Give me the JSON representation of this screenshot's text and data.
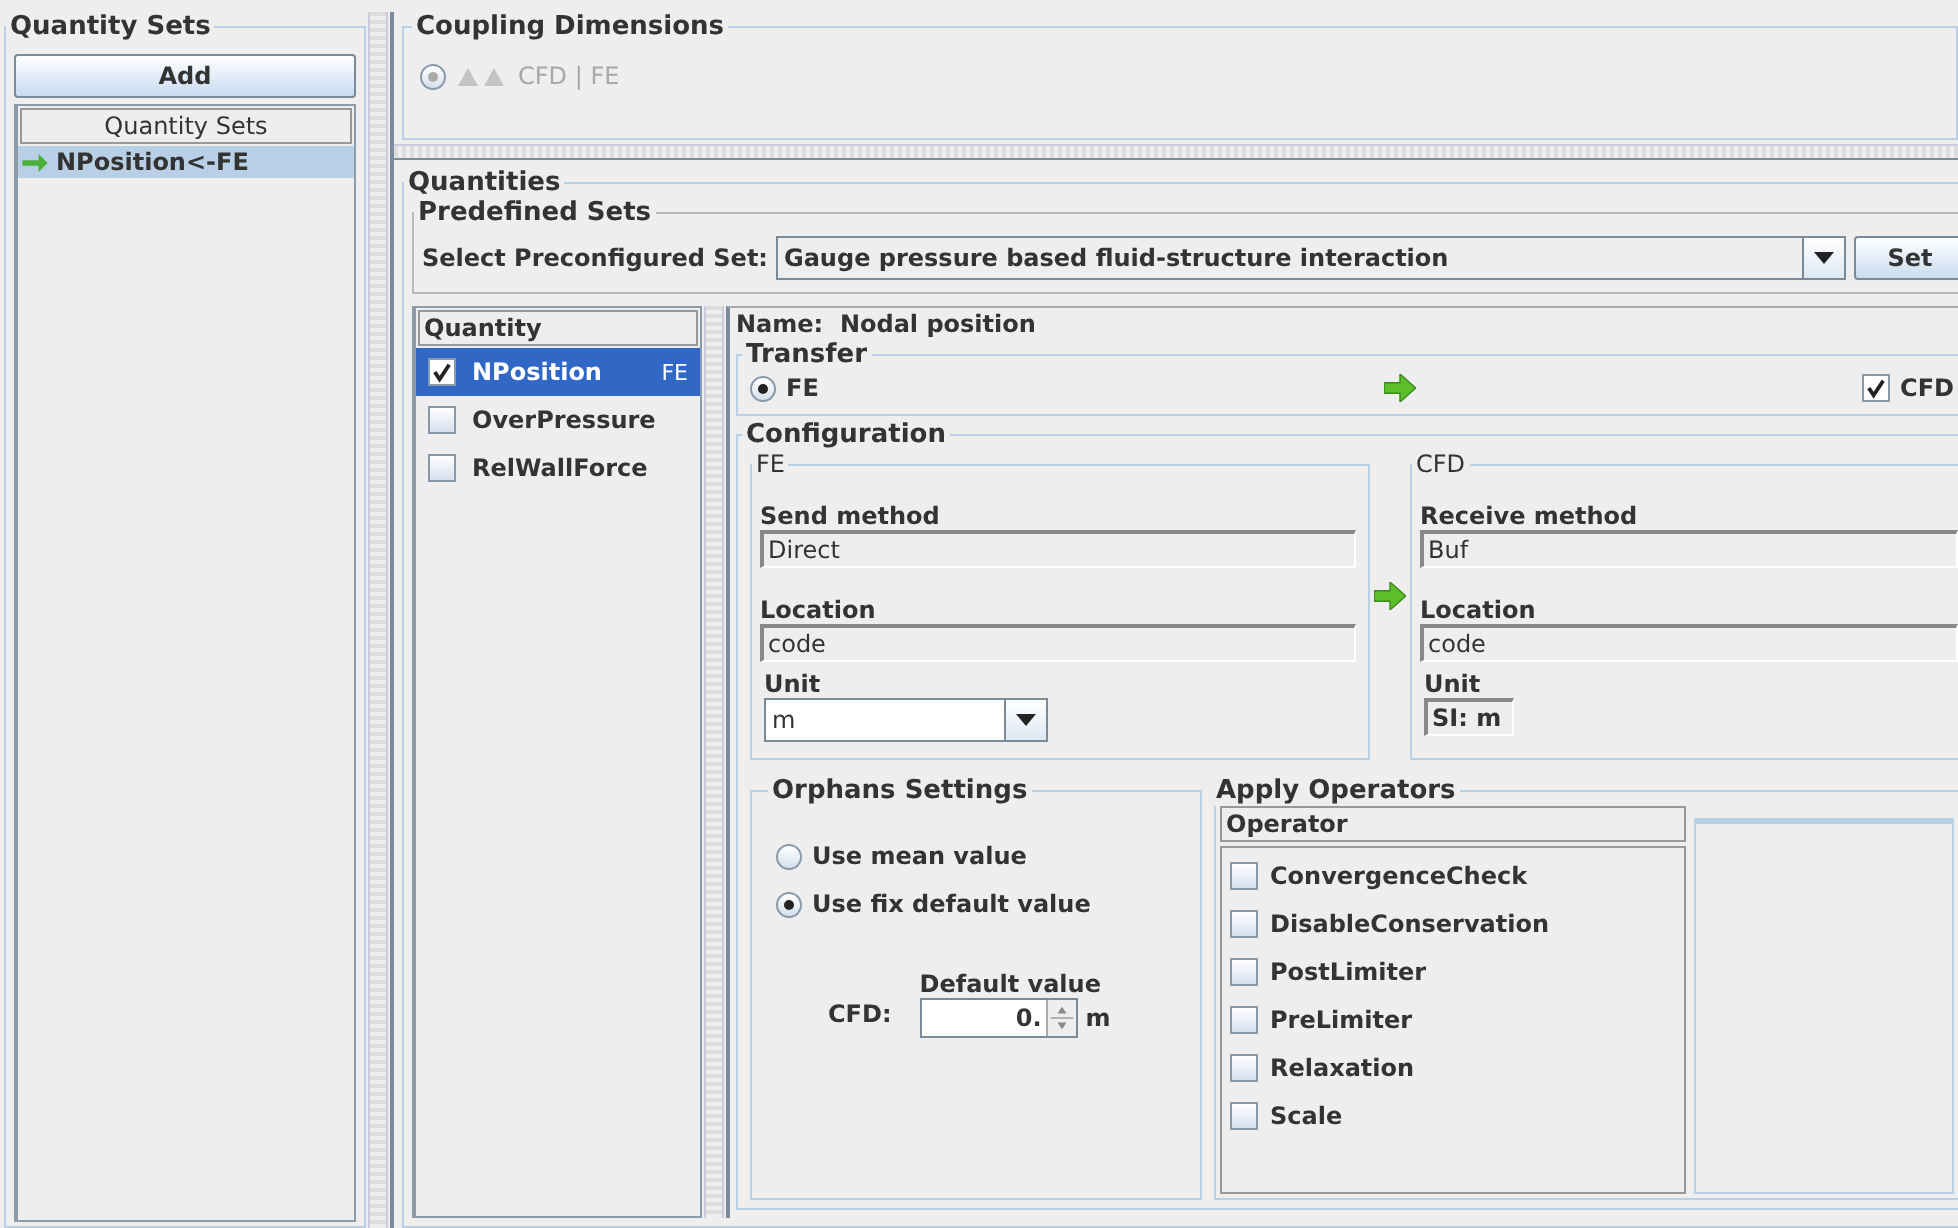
{
  "quantity_sets": {
    "title": "Quantity Sets",
    "add_button": "Add",
    "list_header": "Quantity Sets",
    "items": [
      {
        "label": "NPosition<-FE",
        "selected": true
      }
    ]
  },
  "coupling_dimensions": {
    "title": "Coupling Dimensions",
    "options": [
      {
        "label": "CFD | FE",
        "selected": true,
        "disabled": true
      }
    ]
  },
  "quantities": {
    "title": "Quantities",
    "predefined_sets": {
      "title": "Predefined Sets",
      "label": "Select Preconfigured Set:",
      "value": "Gauge pressure based fluid-structure interaction",
      "button": "Set"
    },
    "list_header": "Quantity",
    "items": [
      {
        "label": "NPosition",
        "tag": "FE",
        "checked": true,
        "selected": true
      },
      {
        "label": "OverPressure",
        "checked": false,
        "selected": false
      },
      {
        "label": "RelWallForce",
        "checked": false,
        "selected": false
      }
    ],
    "detail": {
      "name_label": "Name:",
      "name": "Nodal position",
      "transfer": {
        "title": "Transfer",
        "source": {
          "label": "FE",
          "selected": true
        },
        "target": {
          "label": "CFD",
          "checked": true
        }
      },
      "configuration": {
        "title": "Configuration",
        "sides": [
          {
            "title": "FE",
            "method_label": "Send method",
            "method": "Direct",
            "location_label": "Location",
            "location": "code",
            "unit_label": "Unit",
            "unit": "m",
            "kind": "dropdown"
          },
          {
            "title": "CFD",
            "method_label": "Receive method",
            "method": "Buf",
            "location_label": "Location",
            "location": "code",
            "unit_label": "Unit",
            "unit": "SI: m",
            "kind": "field"
          }
        ]
      },
      "orphans": {
        "title": "Orphans Settings",
        "options": [
          {
            "label": "Use mean value",
            "selected": false
          },
          {
            "label": "Use fix default value",
            "selected": true
          }
        ],
        "side": "CFD:",
        "default_label": "Default value",
        "default_value": "0.",
        "unit": "m"
      },
      "operators": {
        "title": "Apply Operators",
        "header": "Operator",
        "items": [
          {
            "label": "ConvergenceCheck",
            "checked": false
          },
          {
            "label": "DisableConservation",
            "checked": false
          },
          {
            "label": "PostLimiter",
            "checked": false
          },
          {
            "label": "PreLimiter",
            "checked": false
          },
          {
            "label": "Relaxation",
            "checked": false
          },
          {
            "label": "Scale",
            "checked": false
          }
        ]
      }
    }
  }
}
